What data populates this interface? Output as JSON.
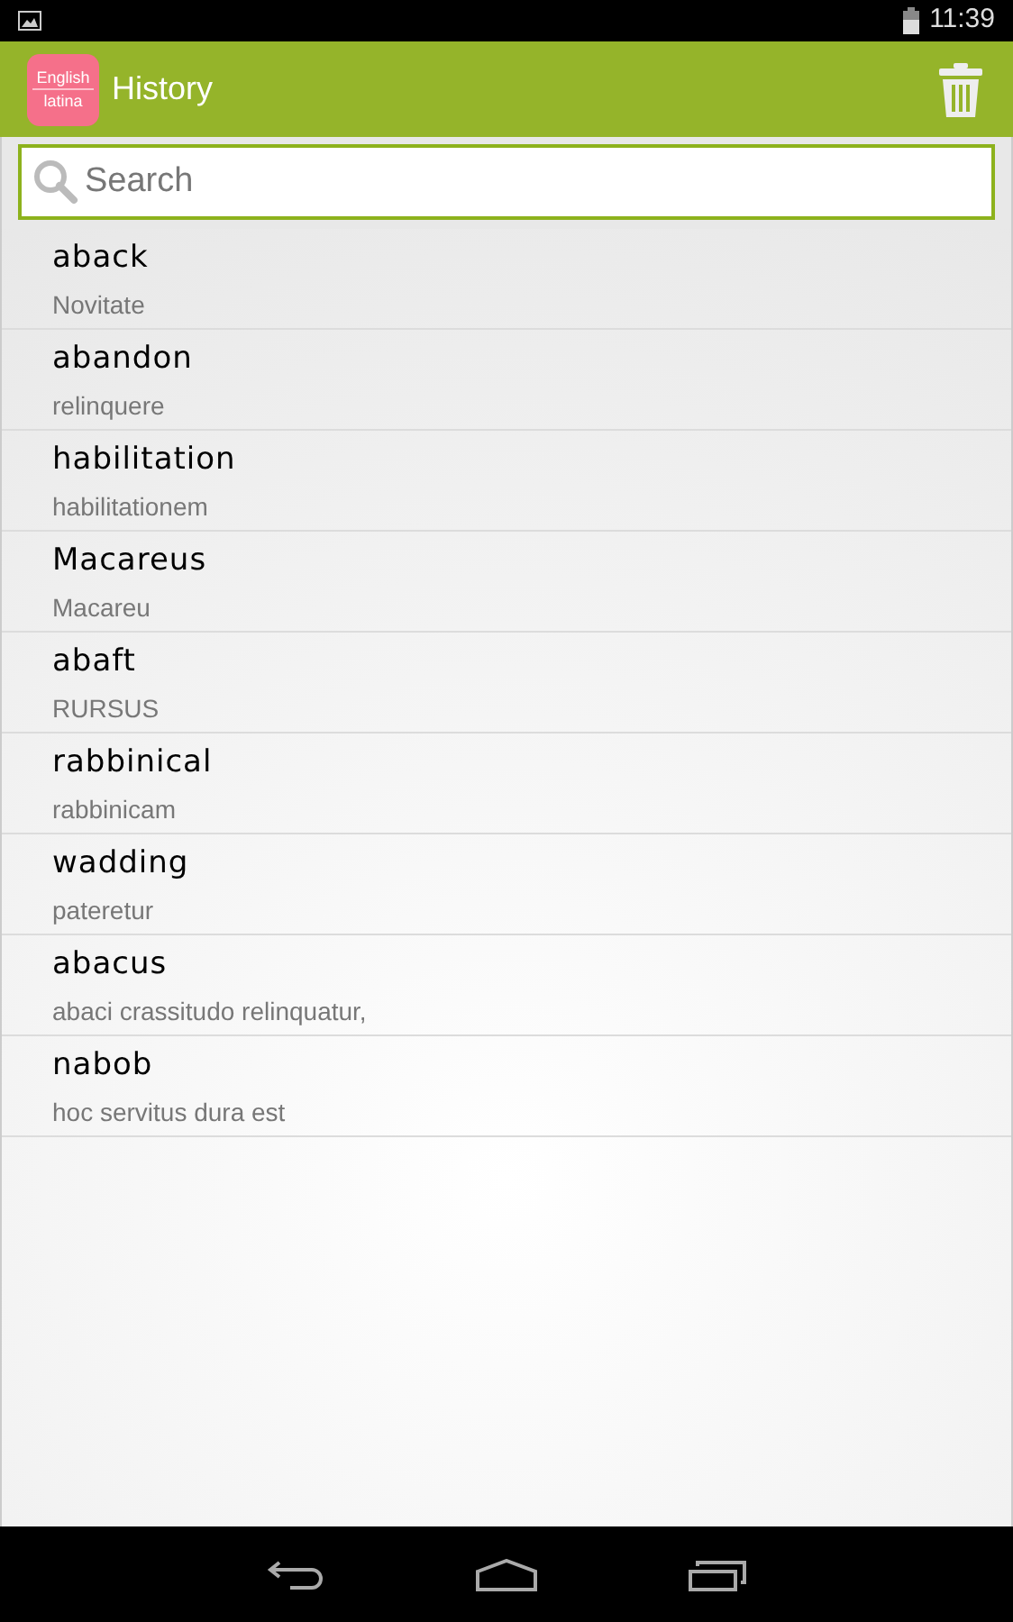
{
  "status_bar": {
    "time": "11:39"
  },
  "action_bar": {
    "logo": {
      "top": "English",
      "bottom": "latina"
    },
    "title": "History"
  },
  "search": {
    "placeholder": "Search"
  },
  "entries": [
    {
      "word": "aback",
      "translation": "Novitate"
    },
    {
      "word": "abandon",
      "translation": "relinquere"
    },
    {
      "word": "habilitation",
      "translation": "habilitationem"
    },
    {
      "word": "Macareus",
      "translation": "Macareu"
    },
    {
      "word": "abaft",
      "translation": "RURSUS"
    },
    {
      "word": "rabbinical",
      "translation": "rabbinicam"
    },
    {
      "word": "wadding",
      "translation": "pateretur"
    },
    {
      "word": "abacus",
      "translation": "abaci crassitudo relinquatur,"
    },
    {
      "word": "nabob",
      "translation": "hoc servitus dura est"
    }
  ]
}
